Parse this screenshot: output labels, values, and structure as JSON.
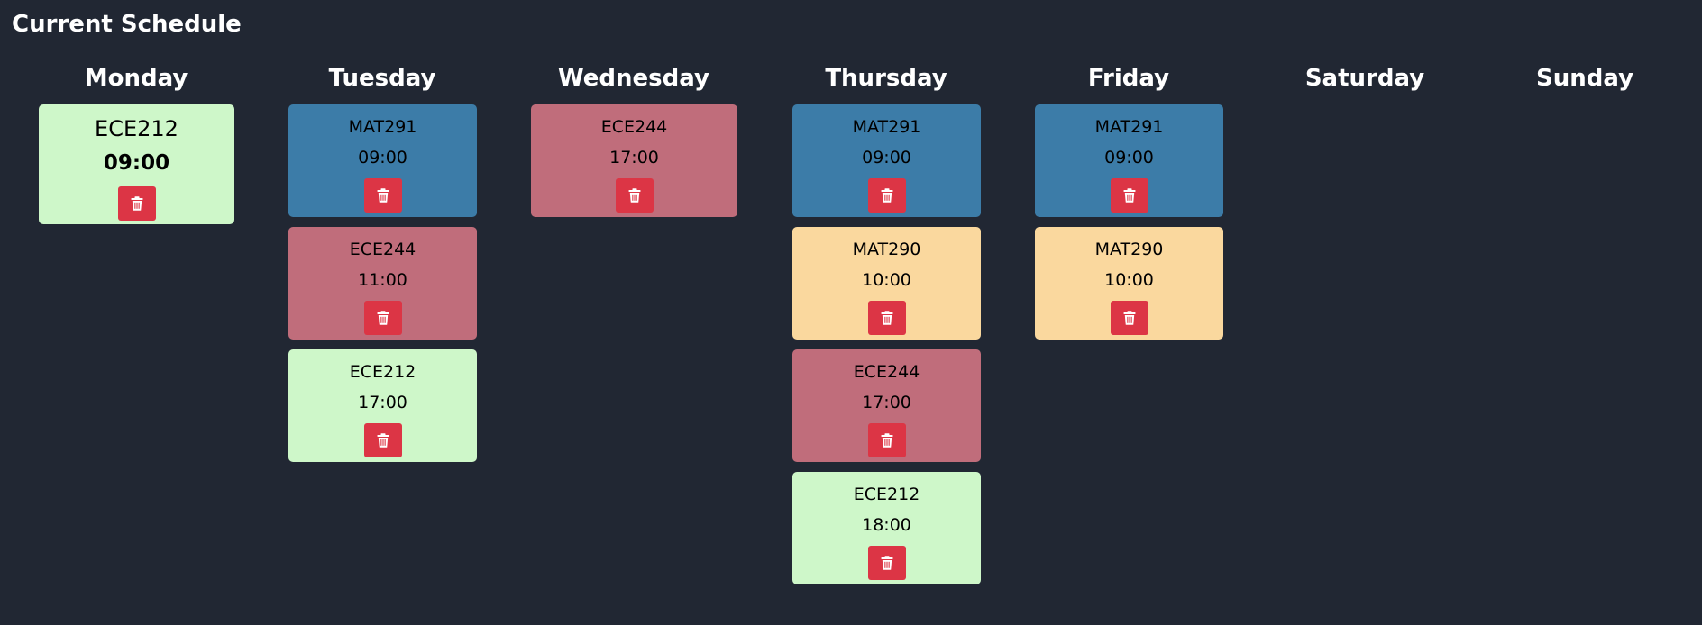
{
  "page_title": "Current Schedule",
  "colors": {
    "background": "#212733",
    "MAT291": "#3c7ca8",
    "ECE244": "#c06d7b",
    "ECE212": "#cef7c9",
    "MAT290": "#fad89e",
    "delete_button": "#dc3545"
  },
  "days": [
    {
      "name": "Monday",
      "events": [
        {
          "course": "ECE212",
          "time": "09:00"
        }
      ]
    },
    {
      "name": "Tuesday",
      "events": [
        {
          "course": "MAT291",
          "time": "09:00"
        },
        {
          "course": "ECE244",
          "time": "11:00"
        },
        {
          "course": "ECE212",
          "time": "17:00"
        }
      ]
    },
    {
      "name": "Wednesday",
      "events": [
        {
          "course": "ECE244",
          "time": "17:00"
        }
      ]
    },
    {
      "name": "Thursday",
      "events": [
        {
          "course": "MAT291",
          "time": "09:00"
        },
        {
          "course": "MAT290",
          "time": "10:00"
        },
        {
          "course": "ECE244",
          "time": "17:00"
        },
        {
          "course": "ECE212",
          "time": "18:00"
        }
      ]
    },
    {
      "name": "Friday",
      "events": [
        {
          "course": "MAT291",
          "time": "09:00"
        },
        {
          "course": "MAT290",
          "time": "10:00"
        }
      ]
    },
    {
      "name": "Saturday",
      "events": []
    },
    {
      "name": "Sunday",
      "events": []
    }
  ],
  "icons": {
    "delete": "trash-icon"
  }
}
